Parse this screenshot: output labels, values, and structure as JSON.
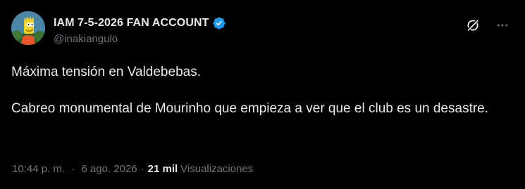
{
  "author": {
    "display_name": "IAM 7-5-2026 FAN ACCOUNT",
    "handle": "@inakiangulo",
    "verified": true,
    "avatar_icon": "cartoon-character-avatar"
  },
  "tweet": {
    "line1": "Máxima tensión en Valdebebas.",
    "line2": "Cabreo monumental de Mourinho que empieza a ver que el club es un desastre."
  },
  "meta": {
    "time": "10:44 p. m.",
    "separator": "·",
    "date": "6 ago. 2026",
    "views_count": "21 mil",
    "views_label": "Visualizaciones"
  },
  "icons": {
    "grok": "grok-icon",
    "more": "more-options-icon",
    "verified": "verified-badge-icon"
  },
  "colors": {
    "background": "#000000",
    "text": "#e7e9ea",
    "secondary": "#71767b",
    "verified": "#1d9bf0"
  }
}
